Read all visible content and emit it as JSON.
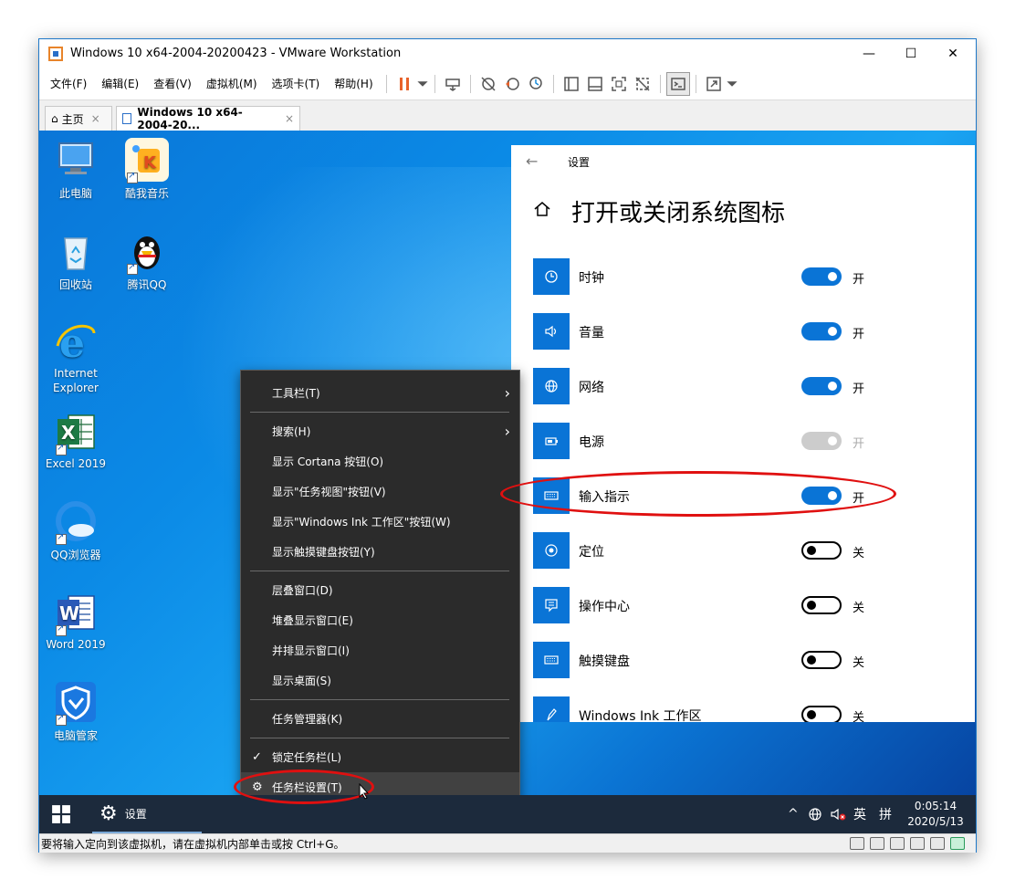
{
  "window": {
    "title": "Windows 10 x64-2004-20200423 - VMware Workstation",
    "minimize": "—",
    "maximize": "☐",
    "close": "✕"
  },
  "menu": [
    "文件(F)",
    "编辑(E)",
    "查看(V)",
    "虚拟机(M)",
    "选项卡(T)",
    "帮助(H)"
  ],
  "tabs": {
    "home": "主页",
    "vm": "Windows 10 x64-2004-20...",
    "close": "×"
  },
  "desktop_icons": [
    "此电脑",
    "酷我音乐",
    "回收站",
    "腾讯QQ",
    "Internet Explorer",
    "Excel 2019",
    "QQ浏览器",
    "Word 2019",
    "电脑管家"
  ],
  "settings": {
    "back": "←",
    "title": "设置",
    "heading": "打开或关闭系统图标",
    "rows": [
      {
        "label": "时钟",
        "state": "开"
      },
      {
        "label": "音量",
        "state": "开"
      },
      {
        "label": "网络",
        "state": "开"
      },
      {
        "label": "电源",
        "state": "开"
      },
      {
        "label": "输入指示",
        "state": "开"
      },
      {
        "label": "定位",
        "state": "关"
      },
      {
        "label": "操作中心",
        "state": "关"
      },
      {
        "label": "触摸键盘",
        "state": "关"
      },
      {
        "label": "Windows Ink 工作区",
        "state": "关"
      }
    ]
  },
  "context_menu": {
    "items": [
      "工具栏(T)",
      "搜索(H)",
      "显示 Cortana 按钮(O)",
      "显示\"任务视图\"按钮(V)",
      "显示\"Windows Ink 工作区\"按钮(W)",
      "显示触摸键盘按钮(Y)",
      "层叠窗口(D)",
      "堆叠显示窗口(E)",
      "并排显示窗口(I)",
      "显示桌面(S)",
      "任务管理器(K)",
      "锁定任务栏(L)",
      "任务栏设置(T)"
    ]
  },
  "taskbar": {
    "app_label": "设置",
    "ime": "英",
    "ime_grid": "拼",
    "time": "0:05:14",
    "date": "2020/5/13"
  },
  "statusbar": {
    "text": "要将输入定向到该虚拟机，请在虚拟机内部单击或按 Ctrl+G。"
  },
  "colors": {
    "accent": "#0a74d6",
    "annotation": "#e01010",
    "taskbar": "#1c2a3c",
    "menu_bg": "#2b2b2b"
  }
}
